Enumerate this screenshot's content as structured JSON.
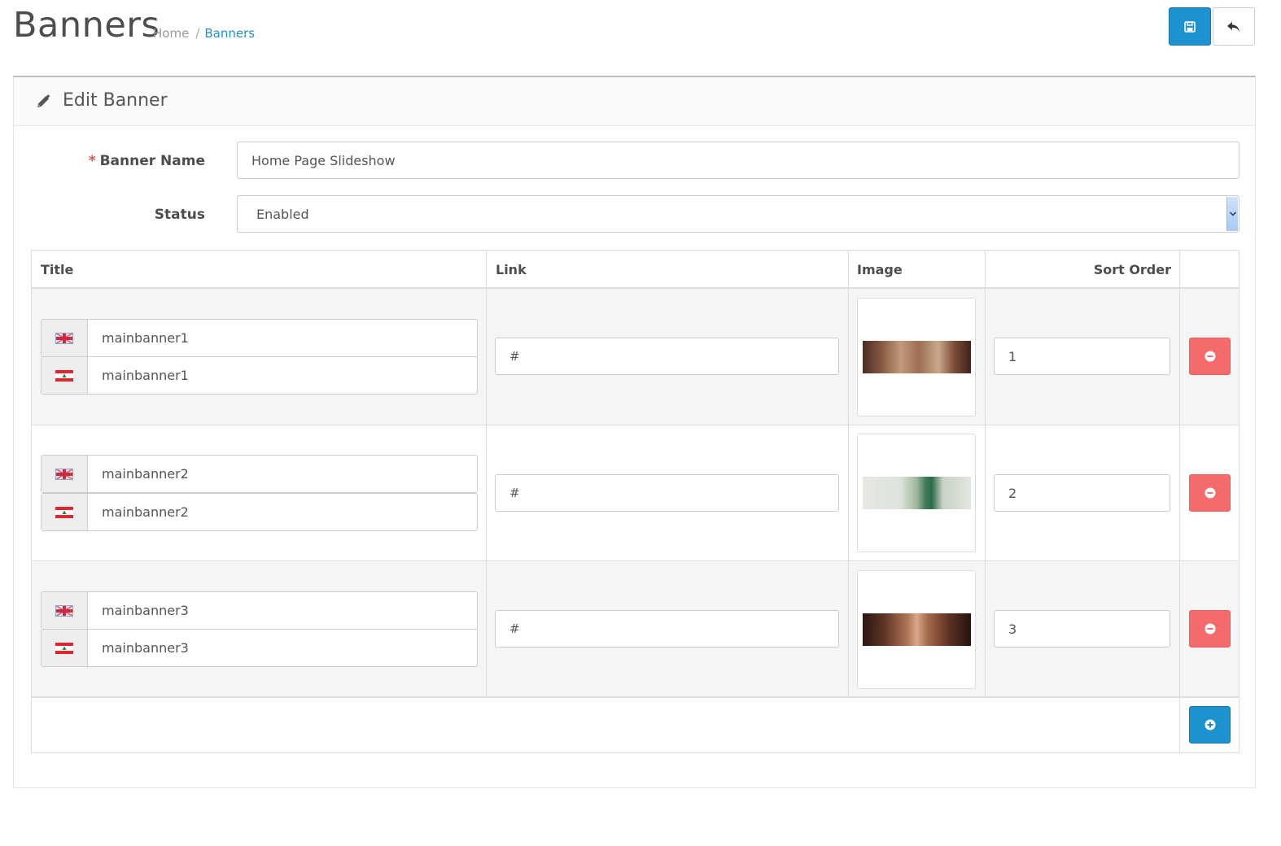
{
  "header": {
    "title": "Banners",
    "breadcrumb": [
      {
        "label": "Home"
      },
      {
        "label": "Banners"
      }
    ],
    "save_icon": "save-icon",
    "back_icon": "reply-icon",
    "primary_color": "#1e91cf"
  },
  "panel": {
    "heading": "Edit Banner",
    "heading_icon": "pencil-icon"
  },
  "form": {
    "banner_name_label": "Banner Name",
    "banner_name_required_mark": "*",
    "banner_name_value": "Home Page Slideshow",
    "status_label": "Status",
    "status_value": "Enabled"
  },
  "table": {
    "columns": [
      "Title",
      "Link",
      "Image",
      "Sort Order"
    ],
    "rows": [
      {
        "titles": [
          {
            "lang_icon": "flag-en-gb-icon",
            "value": "mainbanner1"
          },
          {
            "lang_icon": "flag-lebanon-icon",
            "value": "mainbanner1"
          }
        ],
        "link": "#",
        "image": "banner-thumb-1",
        "sort_order": "1"
      },
      {
        "titles": [
          {
            "lang_icon": "flag-en-gb-icon",
            "value": "mainbanner2"
          },
          {
            "lang_icon": "flag-lebanon-icon",
            "value": "mainbanner2"
          }
        ],
        "link": "#",
        "image": "banner-thumb-2",
        "sort_order": "2"
      },
      {
        "titles": [
          {
            "lang_icon": "flag-en-gb-icon",
            "value": "mainbanner3"
          },
          {
            "lang_icon": "flag-lebanon-icon",
            "value": "mainbanner3"
          }
        ],
        "link": "#",
        "image": "banner-thumb-3",
        "sort_order": "3"
      }
    ],
    "remove_icon": "minus-circle-icon",
    "add_icon": "plus-circle-icon",
    "remove_color": "#f56b6b"
  }
}
